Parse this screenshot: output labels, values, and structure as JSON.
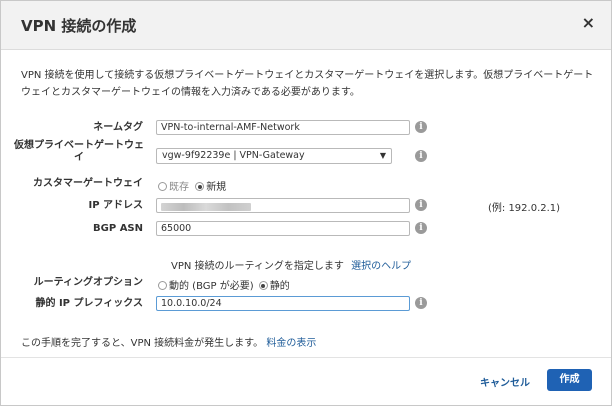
{
  "dialog": {
    "title": "VPN 接続の作成",
    "close_glyph": "×",
    "description": "VPN 接続を使用して接続する仮想プライベートゲートウェイとカスタマーゲートウェイを選択します。仮想プライベートゲートウェイとカスタマーゲートウェイの情報を入力済みである必要があります。"
  },
  "form": {
    "name_tag": {
      "label": "ネームタグ",
      "value": "VPN-to-internal-AMF-Network"
    },
    "vpg": {
      "label": "仮想プライベートゲートウェイ",
      "value": "vgw-9f92239e | VPN-Gateway"
    },
    "customer_gateway": {
      "label": "カスタマーゲートウェイ",
      "opt_existing": "既存",
      "opt_new": "新規",
      "selected": "新規"
    },
    "ip_address": {
      "label": "IP アドレス",
      "example": "(例: 192.0.2.1)"
    },
    "bgp_asn": {
      "label": "BGP ASN",
      "value": "65000"
    },
    "routing_prompt": "VPN 接続のルーティングを指定します",
    "routing_help_link": "選択のヘルプ",
    "routing_option": {
      "label": "ルーティングオプション",
      "opt_dynamic": "動的 (BGP が必要)",
      "opt_static": "静的",
      "selected": "静的"
    },
    "static_prefix": {
      "label": "静的 IP プレフィックス",
      "value": "10.0.10.0/24"
    },
    "info_glyph": "i"
  },
  "footer": {
    "note": "この手順を完了すると、VPN 接続料金が発生します。",
    "pricing_link": "料金の表示",
    "cancel_label": "キャンセル",
    "create_label": "作成"
  },
  "colors": {
    "primary": "#1f62b4",
    "link": "#1f5c99",
    "header_bg": "#f2f2f2"
  }
}
